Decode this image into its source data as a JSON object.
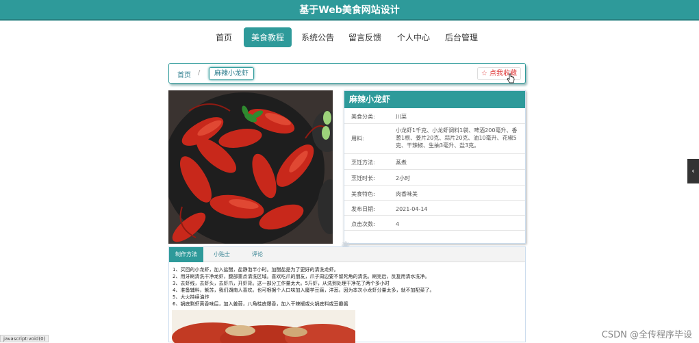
{
  "header": {
    "title": "基于Web美食网站设计"
  },
  "nav": {
    "items": [
      {
        "label": "首页"
      },
      {
        "label": "美食教程"
      },
      {
        "label": "系统公告"
      },
      {
        "label": "留言反馈"
      },
      {
        "label": "个人中心"
      },
      {
        "label": "后台管理"
      }
    ]
  },
  "breadcrumb": {
    "home": "首页",
    "sep": "/",
    "current": "麻辣小龙虾"
  },
  "favorite": {
    "label": "☆ 点我收藏"
  },
  "detail": {
    "title": "麻辣小龙虾",
    "rows": [
      {
        "label": "美食分类:",
        "value": "川菜"
      },
      {
        "label": "用料:",
        "value": "小龙虾1千克、小龙虾调料1袋、啤酒200毫升、香葱1根、姜片20克、蒜片20克、油10毫升、花椒5克、干辣椒、生抽3毫升、盐3克。"
      },
      {
        "label": "烹饪方法:",
        "value": "蒸煮"
      },
      {
        "label": "烹饪时长:",
        "value": "2小时"
      },
      {
        "label": "美食特色:",
        "value": "肉香味美"
      },
      {
        "label": "发布日期:",
        "value": "2021-04-14"
      },
      {
        "label": "点击次数:",
        "value": "4"
      }
    ]
  },
  "tabs": [
    {
      "label": "制作方法"
    },
    {
      "label": "小贴士"
    },
    {
      "label": "评论"
    }
  ],
  "steps": [
    "1、买回的小龙虾，加入盐醋，盐静泡半小时。加醋盐是为了更好的清洗龙虾。",
    "2、用牙刷清洗干净龙虾，腹部重点清洗区域。喜欢吃爪的朋友，爪子周边要不留死角的清洗。刷完后，反复用清水洗净。",
    "3、去虾线，去虾头，去虾爪，开虾背。这一部分工作量太大。5斤虾，从洗到处理干净花了两个多小时",
    "4、准备辅料，紫苏，我们湖南人喜欢。也可根据个人口味加入魔芋豆腐，洋葱。因为本次小龙虾分量太多，就不加配菜了。",
    "5、大火持续油炸",
    "6、锅底剩虾黄香味后，加入姜蒜，八角桂皮爆香，加入干辣椒或火锅底料或豆瓣酱"
  ],
  "side": {
    "arrow": "‹"
  },
  "status": {
    "text": "javascript:void(0)"
  },
  "watermark": {
    "text": "CSDN @全传程序毕设"
  },
  "colors": {
    "primary": "#2e9a9a",
    "favorite": "#e04040"
  }
}
